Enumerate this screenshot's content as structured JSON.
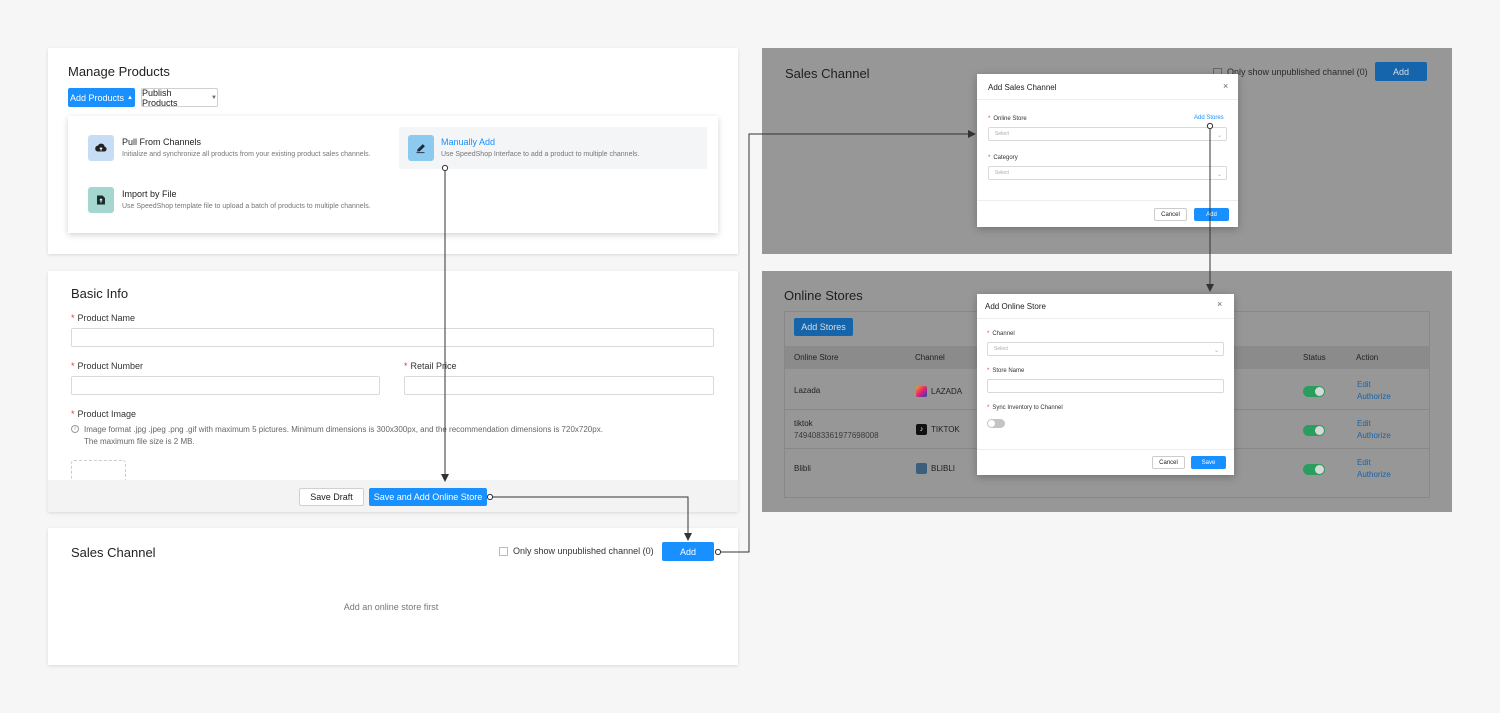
{
  "manage_products": {
    "title": "Manage Products",
    "add_products_label": "Add Products",
    "publish_products_label": "Publish Products",
    "menu": [
      {
        "title": "Pull From Channels",
        "desc": "Initialize and synchronize all products from your existing product sales channels.",
        "icon": "cloud-sync-icon"
      },
      {
        "title": "Manually Add",
        "desc": "Use SpeedShop Interface to add a product to multiple channels.",
        "icon": "pen-icon"
      },
      {
        "title": "Import by File",
        "desc": "Use SpeedShop template file to upload a batch of products to multiple channels.",
        "icon": "file-upload-icon"
      }
    ]
  },
  "basic_info": {
    "title": "Basic Info",
    "product_name_label": "Product Name",
    "product_number_label": "Product Number",
    "retail_price_label": "Retail Price",
    "product_image_label": "Product Image",
    "image_hint_line1": "Image format .jpg .jpeg .png .gif with maximum 5 pictures. Minimum dimensions is 300x300px, and the recommendation dimensions is 720x720px.",
    "image_hint_line2": "The maximum file size is 2 MB.",
    "save_draft_label": "Save Draft",
    "save_add_label": "Save and Add Online Store"
  },
  "sales_channel_bottom": {
    "title": "Sales Channel",
    "only_unpublished_label": "Only show unpublished channel (0)",
    "add_label": "Add",
    "empty_text": "Add an online store first"
  },
  "sales_channel_top": {
    "title": "Sales Channel",
    "only_unpublished_label": "Only show unpublished channel (0)",
    "add_label": "Add"
  },
  "add_sales_channel_modal": {
    "title": "Add Sales Channel",
    "online_store_label": "Online Store",
    "add_stores_link": "Add Stores",
    "online_store_placeholder": "Select",
    "category_label": "Category",
    "category_placeholder": "Select",
    "cancel_label": "Cancel",
    "add_label": "Add"
  },
  "online_stores": {
    "title": "Online Stores",
    "add_stores_label": "Add Stores",
    "columns": {
      "online_store": "Online Store",
      "channel": "Channel",
      "status": "Status",
      "action": "Action"
    },
    "rows": [
      {
        "store": "Lazada",
        "store_id": "",
        "channel": "LAZADA",
        "edit": "Edit",
        "authorize": "Authorize"
      },
      {
        "store": "tiktok",
        "store_id": "7494083361977698008",
        "channel": "TIKTOK",
        "edit": "Edit",
        "authorize": "Authorize"
      },
      {
        "store": "Blibli",
        "store_id": "",
        "channel": "BLIBLI",
        "edit": "Edit",
        "authorize": "Authorize"
      }
    ]
  },
  "add_online_store_modal": {
    "title": "Add Online Store",
    "channel_label": "Channel",
    "channel_placeholder": "Select",
    "store_name_label": "Store Name",
    "sync_label": "Sync Inventory to Channel",
    "cancel_label": "Cancel",
    "save_label": "Save"
  },
  "colors": {
    "accent": "#1890ff",
    "overlay": "#979797",
    "toggle_on": "#2a9d5f",
    "required": "#e4393c"
  }
}
